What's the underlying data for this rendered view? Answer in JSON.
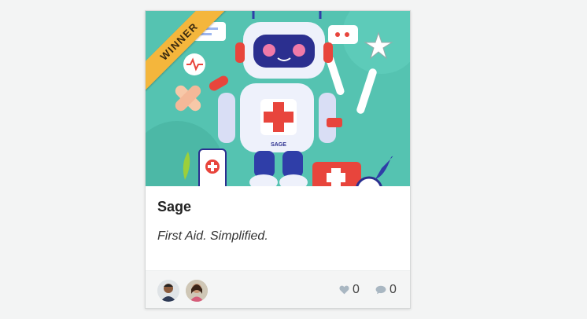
{
  "project": {
    "badge": "WINNER",
    "title": "Sage",
    "tagline": "First Aid. Simplified.",
    "robot_chest_label": "SAGE",
    "likes": "0",
    "comments": "0"
  },
  "icons": {
    "like": "heart-icon",
    "comment": "comment-bubble-icon"
  },
  "colors": {
    "badge": "#f4b63c",
    "thumbnail_background": "#55c3b1",
    "medical_cross": "#e8453c"
  }
}
